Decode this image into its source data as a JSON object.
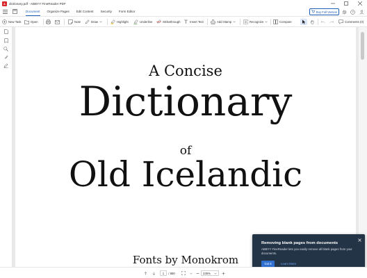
{
  "window": {
    "title": "dictionary.pdf - ABBYY FineReader PDF",
    "logo_text": "A"
  },
  "menu": {
    "items": [
      "Document",
      "Organize Pages",
      "Edit Content",
      "Security",
      "Form Editor"
    ],
    "active": "Document",
    "buy_label": "Buy Full Version"
  },
  "toolbar": {
    "new_task": "New Task",
    "open": "Open",
    "note": "Note",
    "draw": "Draw",
    "highlight": "Highlight",
    "underline": "Underline",
    "strikethrough": "Strikethrough",
    "insert_text": "Insert Text",
    "add_stamp": "Add Stamp",
    "recognize": "Recognize",
    "compare": "Compare",
    "comments": "Comments (0)"
  },
  "document": {
    "line1": "A Concise",
    "line2": "Dictionary",
    "line3": "of",
    "line4": "Old Icelandic",
    "line5": "Fonts by Monokrom"
  },
  "toast": {
    "title": "Removing blank pages from documents",
    "body": "ABBYY FineReader lets you easily remove all blank pages from your documents.",
    "got_it": "Got it",
    "learn_more": "Learn More"
  },
  "status": {
    "page_current": "1",
    "page_total": "/ 880",
    "zoom": "235%"
  },
  "colors": {
    "accent": "#1c5fb8",
    "toast_bg": "#243447",
    "logo": "#d9262a"
  }
}
